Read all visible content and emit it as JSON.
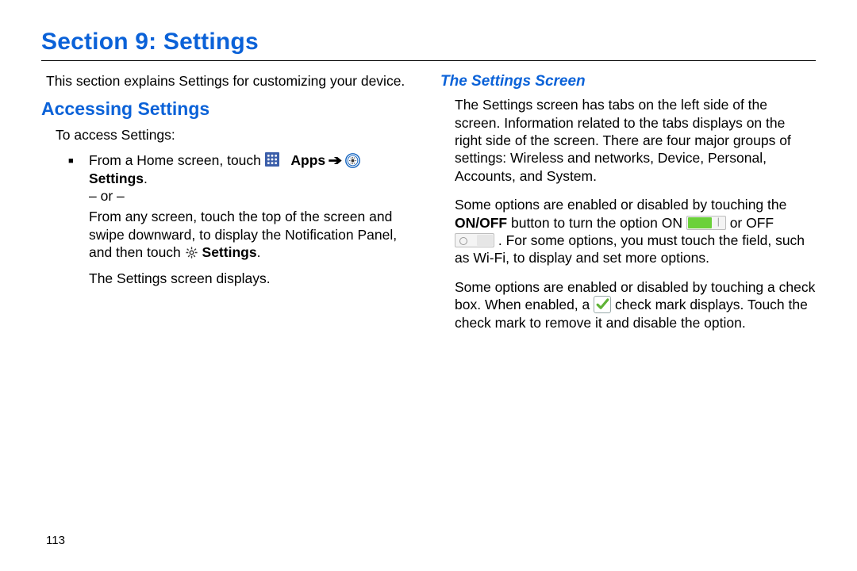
{
  "title": "Section 9: Settings",
  "intro": "This section explains Settings for customizing your device.",
  "left": {
    "heading": "Accessing Settings",
    "lead": "To access Settings:",
    "bullet_prefix": "From a Home screen, touch ",
    "apps_label": "Apps",
    "arrow": "➔",
    "settings_label": "Settings",
    "or": "– or –",
    "swipe_a": "From any screen, touch the top of the screen and swipe downward, to display the Notification Panel, and then touch ",
    "settings_label2": "Settings",
    "displays": "The Settings screen displays."
  },
  "right": {
    "heading": "The Settings Screen",
    "p1": "The Settings screen has tabs on the left side of the screen. Information related to the tabs displays on the right side of the screen. There are four major groups of settings: Wireless and networks, Device, Personal, Accounts, and System.",
    "p2a": "Some options are enabled or disabled by touching the ",
    "onoff": "ON/OFF",
    "p2b": " button to turn the option ON ",
    "p2c": " or OFF ",
    "p2d": ". For some options, you must touch the field, such as Wi-Fi, to display and set more options.",
    "p3a": "Some options are enabled or disabled by touching a check box. When enabled, a ",
    "p3b": " check mark displays. Touch the check mark to remove it and disable the option."
  },
  "page_number": "113"
}
